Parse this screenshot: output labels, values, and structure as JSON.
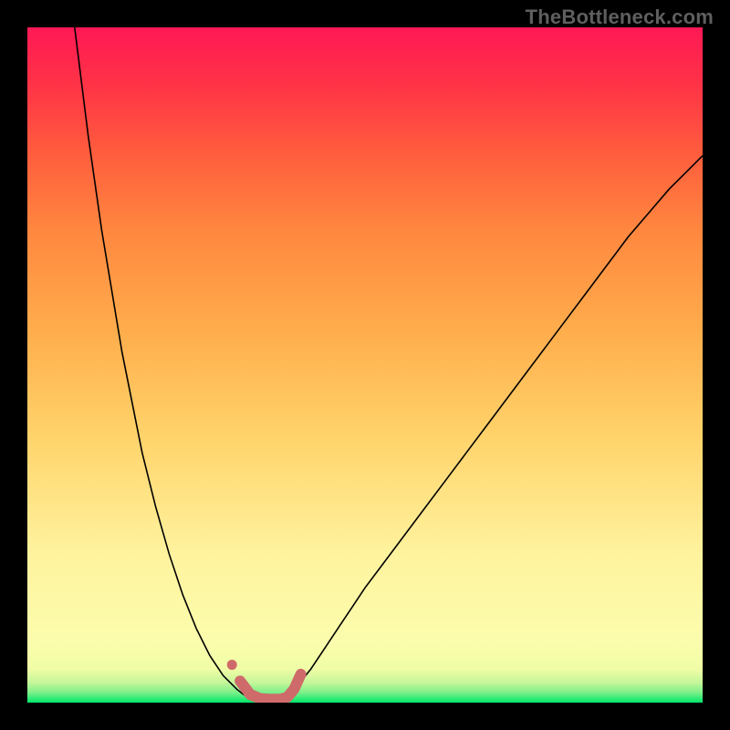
{
  "watermark": "TheBottleneck.com",
  "chart_data": {
    "type": "line",
    "title": "",
    "xlabel": "",
    "ylabel": "",
    "xlim": [
      0,
      100
    ],
    "ylim": [
      0,
      100
    ],
    "grid": false,
    "legend": false,
    "gradient_stops": [
      {
        "offset": 0.0,
        "color": "#00e66a"
      },
      {
        "offset": 0.015,
        "color": "#7df08a"
      },
      {
        "offset": 0.03,
        "color": "#c6f69a"
      },
      {
        "offset": 0.05,
        "color": "#f0fda6"
      },
      {
        "offset": 0.09,
        "color": "#fbfdac"
      },
      {
        "offset": 0.22,
        "color": "#fff39e"
      },
      {
        "offset": 0.4,
        "color": "#ffd269"
      },
      {
        "offset": 0.55,
        "color": "#ffad4c"
      },
      {
        "offset": 0.7,
        "color": "#ff873f"
      },
      {
        "offset": 0.82,
        "color": "#ff5a3e"
      },
      {
        "offset": 0.92,
        "color": "#ff3147"
      },
      {
        "offset": 1.0,
        "color": "#ff1955"
      }
    ],
    "series": [
      {
        "name": "left-curve",
        "stroke": "#000000",
        "stroke_width": 1.6,
        "x": [
          7,
          8,
          9,
          10,
          11,
          12,
          13,
          14,
          15,
          16,
          17,
          18,
          19,
          20,
          21,
          22,
          23,
          24,
          25,
          26,
          27,
          28,
          29,
          30,
          31,
          32,
          33
        ],
        "y": [
          100,
          92,
          84,
          77,
          70,
          64,
          58,
          52,
          47,
          42,
          37,
          33,
          29,
          25.5,
          22,
          19,
          16,
          13.5,
          11,
          9,
          7,
          5.5,
          4,
          3,
          2,
          1.2,
          0.7
        ]
      },
      {
        "name": "right-curve",
        "stroke": "#000000",
        "stroke_width": 1.6,
        "x": [
          38,
          40,
          42,
          44,
          46,
          48,
          50,
          53,
          56,
          59,
          62,
          65,
          68,
          71,
          74,
          77,
          80,
          83,
          86,
          89,
          92,
          95,
          98,
          100
        ],
        "y": [
          0.7,
          2.5,
          5,
          8,
          11,
          14,
          17,
          21,
          25,
          29,
          33,
          37,
          41,
          45,
          49,
          53,
          57,
          61,
          65,
          69,
          72.5,
          76,
          79,
          81
        ]
      },
      {
        "name": "flat-bottom-highlight",
        "stroke": "#cf6a6a",
        "stroke_width": 12,
        "linecap": "round",
        "x": [
          31.5,
          33,
          34.5,
          36,
          37.5,
          38.5,
          39.5,
          40.5
        ],
        "y": [
          3.2,
          1.2,
          0.6,
          0.5,
          0.5,
          0.8,
          2.0,
          4.2
        ]
      }
    ],
    "markers": [
      {
        "name": "left-dot",
        "x": 30.3,
        "y": 5.6,
        "r": 5.5,
        "fill": "#cf6a6a"
      }
    ]
  }
}
